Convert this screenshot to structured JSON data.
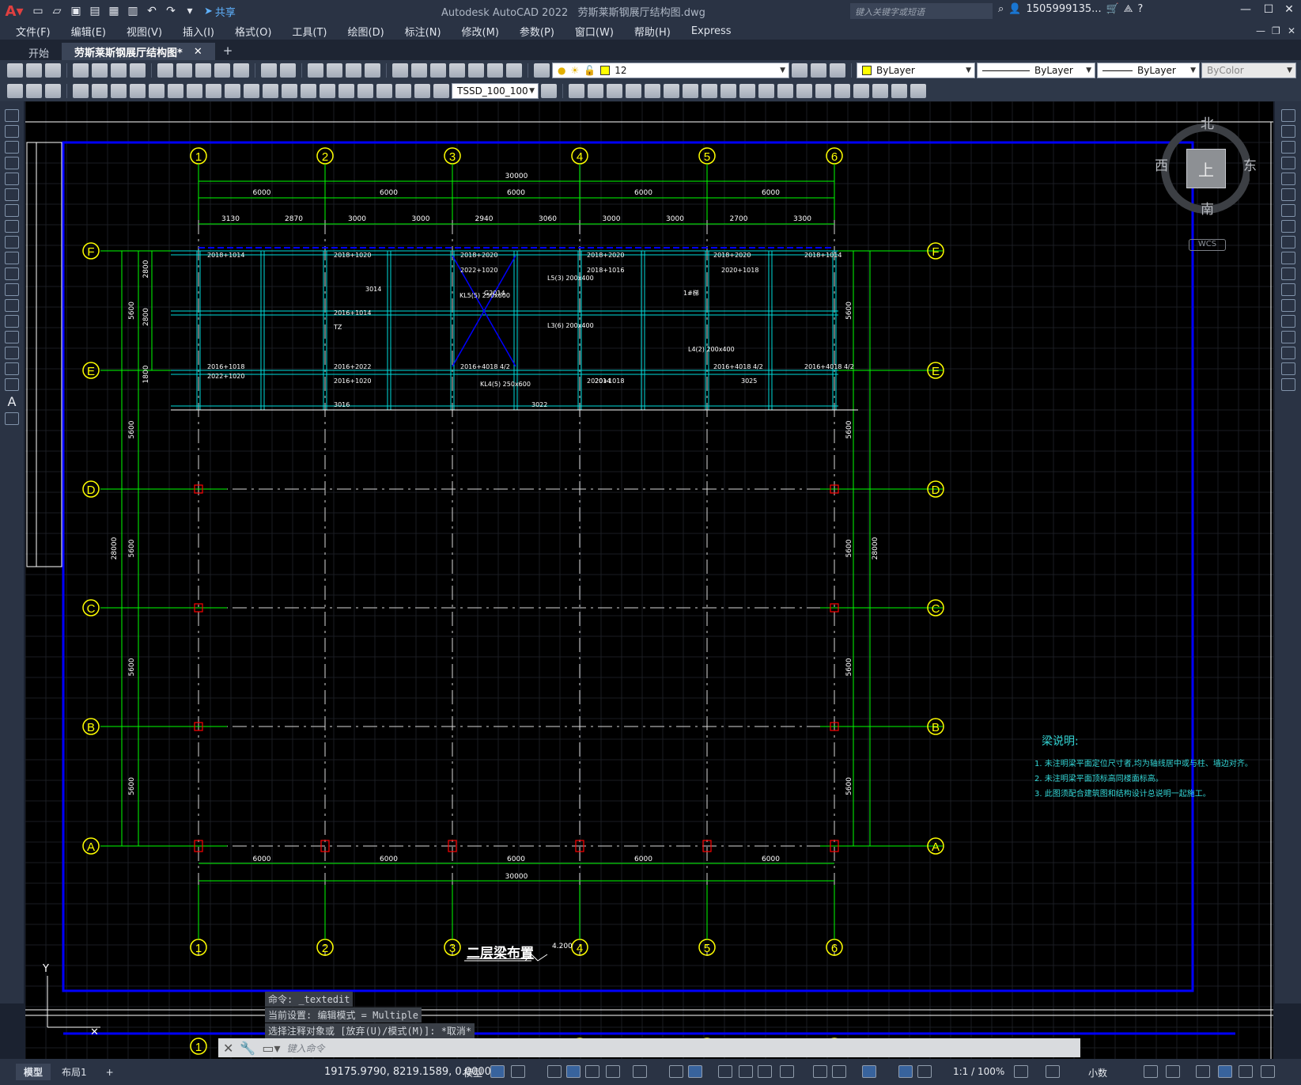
{
  "titlebar": {
    "app_title": "Autodesk AutoCAD 2022",
    "file_title": "劳斯莱斯钢展厅结构图.dwg",
    "share_label": "共享",
    "search_placeholder": "键入关键字或短语",
    "user": "1505999135..."
  },
  "menu": [
    "文件(F)",
    "编辑(E)",
    "视图(V)",
    "插入(I)",
    "格式(O)",
    "工具(T)",
    "绘图(D)",
    "标注(N)",
    "修改(M)",
    "参数(P)",
    "窗口(W)",
    "帮助(H)",
    "Express"
  ],
  "tabs": {
    "start": "开始",
    "drawing": "劳斯莱斯钢展厅结构图*"
  },
  "toolbar": {
    "layer_value": "12",
    "color_value": "ByLayer",
    "linetype_value": "ByLayer",
    "lineweight_value": "ByLayer",
    "plotstyle_value": "ByColor",
    "dimstyle_value": "TSSD_100_100"
  },
  "viewcube": {
    "north": "北",
    "south": "南",
    "east": "东",
    "west": "西",
    "face": "上",
    "wcs": "WCS"
  },
  "drawing": {
    "col_labels": [
      "1",
      "2",
      "3",
      "4",
      "5",
      "6"
    ],
    "row_labels": [
      "F",
      "E",
      "D",
      "C",
      "B",
      "A"
    ],
    "dim_total": "30000",
    "dim_spans": [
      "6000",
      "6000",
      "6000",
      "6000",
      "6000"
    ],
    "dim_sub": [
      "3130",
      "2870",
      "3000",
      "3000",
      "2940",
      "3060",
      "3000",
      "3000",
      "2700",
      "3300"
    ],
    "dim_total_vert": "28000",
    "dim_vert": [
      "5600",
      "5600",
      "5600",
      "5600",
      "5600"
    ],
    "dim_vert_sub": [
      "2800",
      "2800",
      "1800"
    ],
    "beam_labels": [
      "2018+1014",
      "2018+1020",
      "2018+2020",
      "2018+2020",
      "2018+2020",
      "2018+1014",
      "2022+1020",
      "2018+1016",
      "2020+1018",
      "2016+1014",
      "2016+1018",
      "2016+2022",
      "2016+4018 4/2",
      "2016+4018 4/2",
      "2016+4018 4/2",
      "2016+1020",
      "2020+1018",
      "2022+1020",
      "3016",
      "G2014",
      "3014",
      "1#梯",
      "L4(2) 200x400",
      "L5(3) 200x400",
      "KL4(5) 250x600",
      "KL5(5) 250x600",
      "L3(6) 200x400",
      "TZ",
      "2014",
      "3025",
      "3022"
    ]
  },
  "notes": {
    "title": "梁说明:",
    "items": [
      "1. 未注明梁平面定位尺寸者,均为轴线居中或与柱、墙边对齐。",
      "2. 未注明梁平面顶标高同楼面标高。",
      "3. 此图须配合建筑图和结构设计总说明一起施工。"
    ]
  },
  "plan": {
    "title": "二层梁布置",
    "elevation": "4.200"
  },
  "command": {
    "history": [
      "命令: _textedit",
      "当前设置: 编辑模式 = Multiple",
      "选择注释对象或 [放弃(U)/模式(M)]: *取消*"
    ],
    "placeholder": "键入命令"
  },
  "statusbar": {
    "layout_tabs": [
      "模型",
      "布局1"
    ],
    "coords": "19175.9790, 8219.1589, 0.0000",
    "model_label": "模型",
    "scale": "1:1 / 100%",
    "units": "小数"
  },
  "colors": {
    "axis": "#00ff00",
    "bubble": "#ffff00",
    "beam": "#00dddd",
    "border": "#0000ff",
    "column": "#ff0000"
  }
}
